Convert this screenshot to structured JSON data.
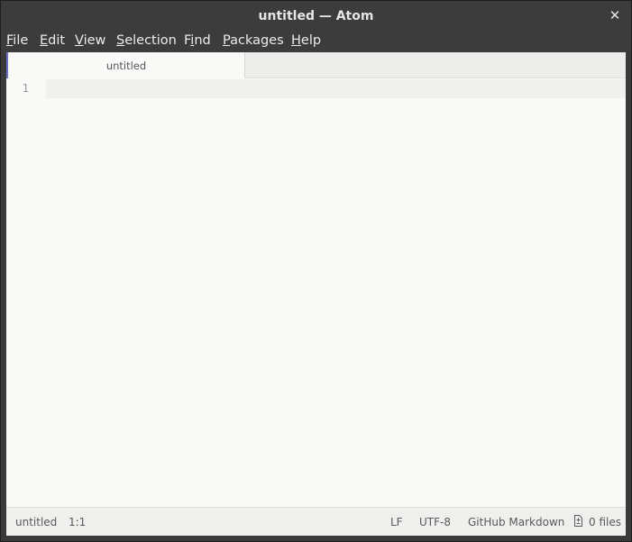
{
  "window": {
    "title": "untitled — Atom",
    "close_glyph": "✕"
  },
  "menubar": {
    "items": [
      {
        "label": "File",
        "mnemonic": "F",
        "rest": "ile"
      },
      {
        "label": "Edit",
        "mnemonic": "E",
        "rest": "dit"
      },
      {
        "label": "View",
        "mnemonic": "V",
        "rest": "iew"
      },
      {
        "label": "Selection",
        "mnemonic": "S",
        "rest": "election"
      },
      {
        "label": "Find",
        "pre": "F",
        "mnemonic": "i",
        "rest": "nd"
      },
      {
        "label": "Packages",
        "mnemonic": "P",
        "rest": "ackages"
      },
      {
        "label": "Help",
        "mnemonic": "H",
        "rest": "elp"
      }
    ]
  },
  "tabs": [
    {
      "label": "untitled",
      "active": true
    }
  ],
  "editor": {
    "line_numbers": [
      "1"
    ]
  },
  "statusbar": {
    "file_name": "untitled",
    "cursor_position": "1:1",
    "line_ending": "LF",
    "encoding": "UTF-8",
    "grammar": "GitHub Markdown",
    "git_files": "0 files",
    "git_icon": "file-diff-icon"
  },
  "colors": {
    "titlebar": "#3c3c3c",
    "editor_bg": "#f9f9f8",
    "active_tab_accent": "#6b6fc9"
  }
}
